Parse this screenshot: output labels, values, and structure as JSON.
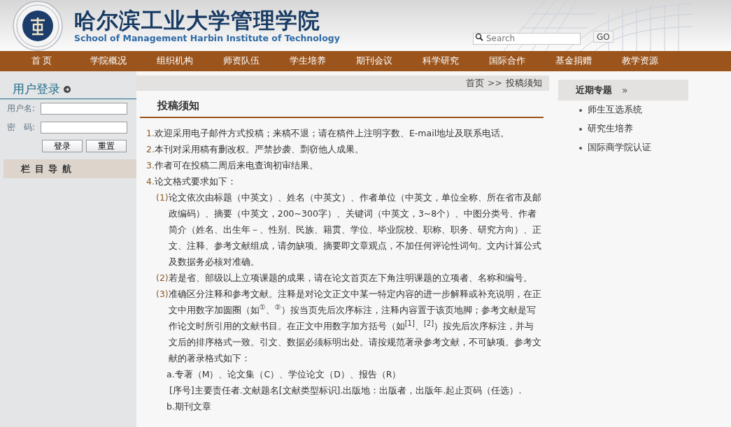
{
  "header": {
    "title": "哈尔滨工业大学管理学院",
    "subtitle": "School of Management Harbin Institute of Technology",
    "search": {
      "placeholder": "Search"
    },
    "go_button": "GO"
  },
  "nav": [
    "首 页",
    "学院概况",
    "组织机构",
    "师资队伍",
    "学生培养",
    "期刊会议",
    "科学研究",
    "国际合作",
    "基金捐赠",
    "教学资源"
  ],
  "login": {
    "title": "用户登录",
    "username_label": "用户名:",
    "password_label": "密　码:",
    "buttons": [
      "登录",
      "重置"
    ]
  },
  "sidebar": {
    "heading": "栏 目 导 航"
  },
  "breadcrumb": {
    "home": "首页",
    "separator": ">>",
    "current": "投稿须知"
  },
  "article": {
    "title": "投稿须知",
    "items": [
      {
        "marker": "1.",
        "text": "欢迎采用电子邮件方式投稿；来稿不退；请在稿件上注明字数、E-mail地址及联系电话。"
      },
      {
        "marker": "2.",
        "text": "本刊对采用稿有删改权。严禁抄袭、剽窃他人成果。"
      },
      {
        "marker": "3.",
        "text": "作者可在投稿二周后来电查询初审结果。"
      },
      {
        "marker": "4.",
        "text": "论文格式要求如下：",
        "children": [
          {
            "marker": "(1)",
            "text": "论文依次由标题（中英文）、姓名（中英文）、作者单位（中英文，单位全称、所在省市及邮政编码）、摘要（中英文，200~300字）、关键词（中英文，3~8个）、中图分类号、作者简介（姓名、出生年－、性别、民族、籍贯、学位、毕业院校、职称、职务、研究方向）、正文、注释、参考文献组成，请勿缺项。摘要即文章观点，不加任何评论性词句。文内计算公式及数据务必核对准确。"
          },
          {
            "marker": "(2)",
            "text": "若是省、部级以上立项课题的成果，请在论文首页左下角注明课题的立项者、名称和编号。"
          },
          {
            "marker": "(3)",
            "text": "准确区分注释和参考文献。注释是对论文正文中某一特定内容的进一步解释或补充说明，在正文中用数字加圆圈（如$^{①}$、$^{②}$）按当页先后次序标注，注释内容置于该页地脚；参考文献是写作论文时所引用的文献书目。在正文中用数字加方括号（如$^{[1]}$、$^{[2]}$）按先后次序标注，并与文后的排序格式一致。引文、数据必须标明出处。请按规范著录参考文献，不可缺项。参考文献的著录格式如下：",
            "children": [
              {
                "text": "a.专著（M）、论文集（C）、学位论文（D）、报告（R）"
              },
              {
                "text": " [序号]主要责任者.文献题名[文献类型标识].出版地：出版者，出版年.起止页码（任选）."
              },
              {
                "text": "b.期刊文章"
              }
            ]
          }
        ]
      }
    ]
  },
  "topics": {
    "title": "近期专题",
    "arrow": "»",
    "items": [
      "师生互选系统",
      "研究生培养",
      "国际商学院认证"
    ]
  }
}
